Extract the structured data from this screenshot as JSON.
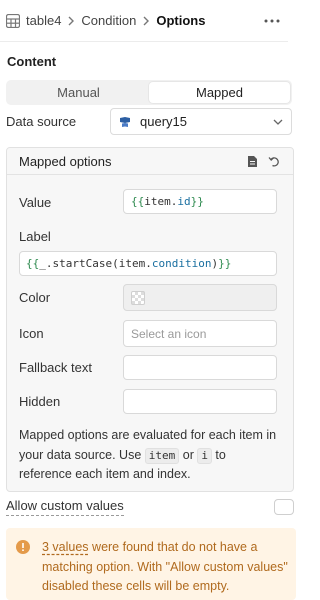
{
  "breadcrumb": {
    "items": [
      "table4",
      "Condition",
      "Options"
    ]
  },
  "content": {
    "section_title": "Content",
    "mode_tabs": [
      {
        "label": "Manual",
        "active": false
      },
      {
        "label": "Mapped",
        "active": true
      }
    ],
    "data_source": {
      "label": "Data source",
      "value": "query15"
    }
  },
  "mapped_options": {
    "title": "Mapped options",
    "value": {
      "label": "Value",
      "code": {
        "open": "{{ ",
        "var": "item",
        "dot": ".",
        "prop": "id",
        "close": " }}"
      }
    },
    "label_field": {
      "label": "Label",
      "code": {
        "open": "{{ ",
        "fn": "_.startCase(",
        "var": "item",
        "dot": ".",
        "prop": "condition",
        "end": ")",
        "close": " }}"
      }
    },
    "color": {
      "label": "Color"
    },
    "icon": {
      "label": "Icon",
      "placeholder": "Select an icon"
    },
    "fallback_text": {
      "label": "Fallback text",
      "value": ""
    },
    "hidden": {
      "label": "Hidden",
      "value": ""
    },
    "help": {
      "part1": "Mapped options are evaluated for each item in your data source. Use ",
      "kbd1": "item",
      "part2": " or ",
      "kbd2": "i",
      "part3": " to reference each item and index."
    }
  },
  "allow_custom_values": {
    "label": "Allow custom values",
    "checked": false
  },
  "warning": {
    "link_text": "3 values",
    "text": " were found that do not have a matching option. With \"Allow custom values\" disabled these cells will be empty."
  },
  "colors": {
    "warning_bg": "#fff4e5",
    "warning_text": "#b06a1e",
    "template_brace": "#2e8a4f",
    "property": "#1a6fa0"
  },
  "icons": {
    "table": "table-icon",
    "more": "more-horizontal-icon",
    "query": "query-icon",
    "chevron": "chevron-down-icon",
    "doc": "document-icon",
    "reset": "reset-icon",
    "warning": "alert-circle-icon"
  }
}
